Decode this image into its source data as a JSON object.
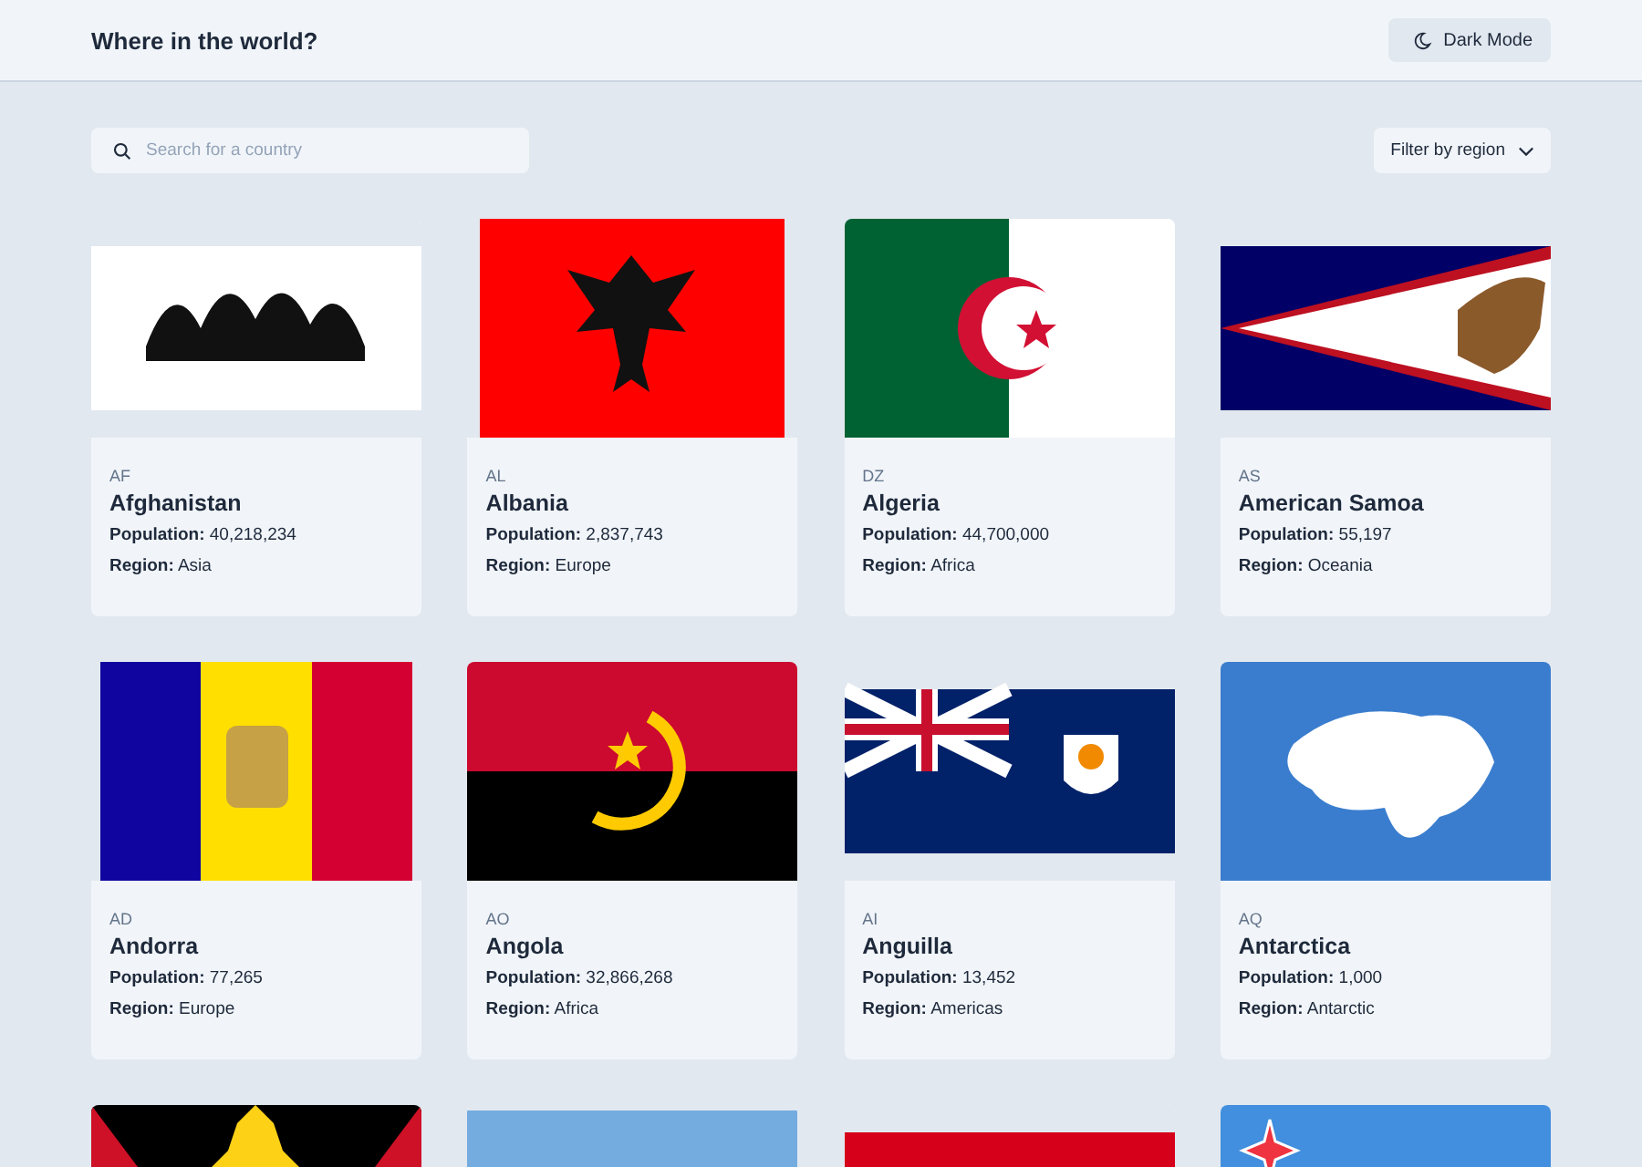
{
  "header": {
    "title": "Where in the world?",
    "theme_button": "Dark Mode"
  },
  "search": {
    "placeholder": "Search for a country"
  },
  "filter": {
    "label": "Filter by region"
  },
  "cards": [
    {
      "kind": "full",
      "code": "AF",
      "name": "Afghanistan",
      "population_label": "Population:",
      "population": "40,218,234",
      "region_label": "Region:",
      "region": "Asia"
    },
    {
      "kind": "full",
      "code": "AL",
      "name": "Albania",
      "population_label": "Population:",
      "population": "2,837,743",
      "region_label": "Region:",
      "region": "Europe"
    },
    {
      "kind": "full",
      "code": "DZ",
      "name": "Algeria",
      "population_label": "Population:",
      "population": "44,700,000",
      "region_label": "Region:",
      "region": "Africa"
    },
    {
      "kind": "full",
      "code": "AS",
      "name": "American Samoa",
      "population_label": "Population:",
      "population": "55,197",
      "region_label": "Region:",
      "region": "Oceania"
    },
    {
      "kind": "full",
      "code": "AD",
      "name": "Andorra",
      "population_label": "Population:",
      "population": "77,265",
      "region_label": "Region:",
      "region": "Europe"
    },
    {
      "kind": "full",
      "code": "AO",
      "name": "Angola",
      "population_label": "Population:",
      "population": "32,866,268",
      "region_label": "Region:",
      "region": "Africa"
    },
    {
      "kind": "full",
      "code": "AI",
      "name": "Anguilla",
      "population_label": "Population:",
      "population": "13,452",
      "region_label": "Region:",
      "region": "Americas"
    },
    {
      "kind": "full",
      "code": "AQ",
      "name": "Antarctica",
      "population_label": "Population:",
      "population": "1,000",
      "region_label": "Region:",
      "region": "Antarctic"
    },
    {
      "kind": "flag-only"
    },
    {
      "kind": "flag-only"
    },
    {
      "kind": "flag-only"
    },
    {
      "kind": "flag-only"
    }
  ]
}
